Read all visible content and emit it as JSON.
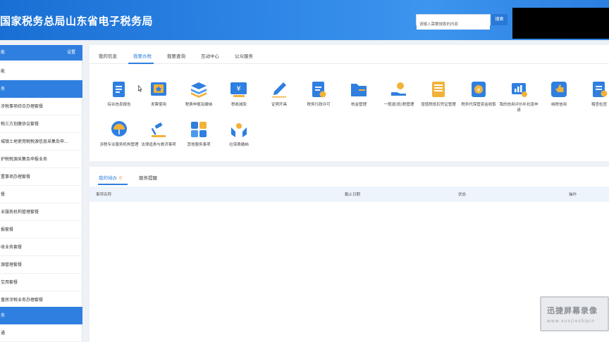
{
  "header": {
    "title": "国家税务总局山东省电子税务局",
    "search_placeholder": "请输入需要搜索的内容",
    "search_button": "搜索"
  },
  "sidebar": {
    "settings_label": "设置",
    "items": [
      {
        "label": "能",
        "highlight": true
      },
      {
        "label": "能",
        "highlight": false
      },
      {
        "label": "务",
        "highlight": true
      },
      {
        "label": "涉税事项综合办理套餐",
        "highlight": false
      },
      {
        "label": "税三方划缴协议套餐",
        "highlight": false
      },
      {
        "label": "城镇土地使用税税源信息采集及申...",
        "highlight": false
      },
      {
        "label": "护税税源采集及申报业务",
        "highlight": false
      },
      {
        "label": "置事项办理套餐",
        "highlight": false
      },
      {
        "label": "餐",
        "highlight": false
      },
      {
        "label": "业服务机构管理套餐",
        "highlight": false
      },
      {
        "label": "报套餐",
        "highlight": false
      },
      {
        "label": "收业务套餐",
        "highlight": false
      },
      {
        "label": "源管理套餐",
        "highlight": false
      },
      {
        "label": "交用套餐",
        "highlight": false
      },
      {
        "label": "量房涉税业务办理套餐",
        "highlight": false
      },
      {
        "label": "务",
        "highlight": true
      },
      {
        "label": "通",
        "highlight": false
      }
    ]
  },
  "tabs": [
    {
      "label": "我的信息",
      "active": false
    },
    {
      "label": "我要办税",
      "active": true
    },
    {
      "label": "我要查询",
      "active": false
    },
    {
      "label": "互动中心",
      "active": false
    },
    {
      "label": "公众服务",
      "active": false
    }
  ],
  "functions": [
    {
      "label": "综合信息报告",
      "icon": "document-icon"
    },
    {
      "label": "发票使用",
      "icon": "invoice-icon"
    },
    {
      "label": "税费申报及缴纳",
      "icon": "layers-icon"
    },
    {
      "label": "税收减免",
      "icon": "tax-relief-icon"
    },
    {
      "label": "证明开具",
      "icon": "pen-icon"
    },
    {
      "label": "税务行政许可",
      "icon": "permit-icon"
    },
    {
      "label": "核金管理",
      "icon": "folder-icon"
    },
    {
      "label": "一般退(抵)税管理",
      "icon": "refund-hand-icon"
    },
    {
      "label": "增值税抵扣凭证管理",
      "icon": "ledger-icon"
    },
    {
      "label": "税务代保管资金收取",
      "icon": "safe-money-icon"
    },
    {
      "label": "我的信用评价补抗息申请",
      "icon": "credit-chart-icon"
    },
    {
      "label": "纳税信用",
      "icon": "thumb-up-icon"
    },
    {
      "label": "稽查检查",
      "icon": "inspection-icon"
    },
    {
      "label": "涉税专业服务机构管理",
      "icon": "umbrella-icon"
    },
    {
      "label": "法律追责与救济事项",
      "icon": "gavel-icon"
    },
    {
      "label": "其他服务事项",
      "icon": "grid-icon"
    },
    {
      "label": "社保费缴纳",
      "icon": "family-hands-icon"
    }
  ],
  "bottom_tabs": [
    {
      "label": "我的待办",
      "count": "0",
      "active": true
    },
    {
      "label": "服务提醒",
      "count": "",
      "active": false
    }
  ],
  "table_headers": [
    "事项名称",
    "截止日期",
    "状态",
    "操作"
  ],
  "watermark": {
    "line1": "迅捷屏幕录像",
    "line2": "www.xunjieshipin"
  },
  "colors": {
    "brand_blue": "#2f7fe0",
    "header_blue": "#1a6fd4",
    "orange": "#f08a24"
  }
}
